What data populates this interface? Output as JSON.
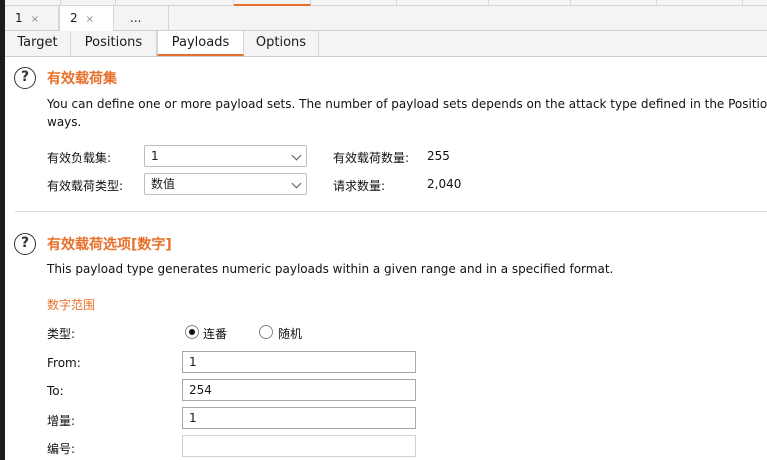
{
  "tabs": [
    {
      "label": "1",
      "close": "×"
    },
    {
      "label": "2",
      "close": "×"
    },
    {
      "label": "..."
    }
  ],
  "sub_tabs": [
    {
      "label": "Target"
    },
    {
      "label": "Positions"
    },
    {
      "label": "Payloads"
    },
    {
      "label": "Options"
    }
  ],
  "payload_sets": {
    "help": "?",
    "title": "有效载荷集",
    "description": "You can define one or more payload sets. The number of payload sets depends on the attack type defined in the Positions",
    "description2": "ways.",
    "set_label": "有效负载集:",
    "set_value": "1",
    "type_label": "有效载荷类型:",
    "type_value": "数值",
    "count_label": "有效载荷数量:",
    "count_value": "255",
    "requests_label": "请求数量:",
    "requests_value": "2,040"
  },
  "payload_options": {
    "help": "?",
    "title": "有效载荷选项[数字]",
    "description": "This payload type generates numeric payloads within a given range and in a specified format.",
    "range_title": "数字范围",
    "type_label": "类型:",
    "radio_sequential": "连番",
    "radio_random": "随机",
    "from_label": "From:",
    "from_value": "1",
    "to_label": "To:",
    "to_value": "254",
    "step_label": "增量:",
    "step_value": "1",
    "number_label": "编号:",
    "number_value": ""
  },
  "colors": {
    "accent": "#e8702a"
  }
}
